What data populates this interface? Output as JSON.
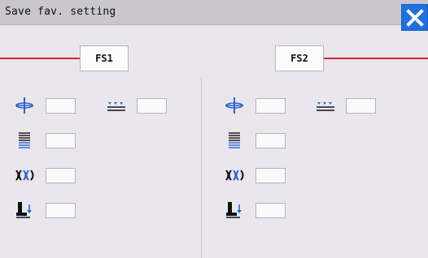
{
  "window": {
    "title": "Save fav. setting"
  },
  "buttons": {
    "fs1_label": "FS1",
    "fs2_label": "FS2"
  },
  "panels": [
    {
      "name": "FS1",
      "rows": [
        {
          "icon": "needle-position-icon",
          "value": ""
        },
        {
          "icon": "stitch-length-icon",
          "value": ""
        },
        {
          "icon": "thread-tension-icon",
          "value": ""
        },
        {
          "icon": "presser-foot-icon",
          "value": ""
        }
      ],
      "extra": {
        "icon": "feed-icon",
        "value": ""
      }
    },
    {
      "name": "FS2",
      "rows": [
        {
          "icon": "needle-position-icon",
          "value": ""
        },
        {
          "icon": "stitch-length-icon",
          "value": ""
        },
        {
          "icon": "thread-tension-icon",
          "value": ""
        },
        {
          "icon": "presser-foot-icon",
          "value": ""
        }
      ],
      "extra": {
        "icon": "feed-icon",
        "value": ""
      }
    }
  ],
  "colors": {
    "accent": "#1f6fe0",
    "line": "#d7233b",
    "background": "#e9e6ee"
  }
}
